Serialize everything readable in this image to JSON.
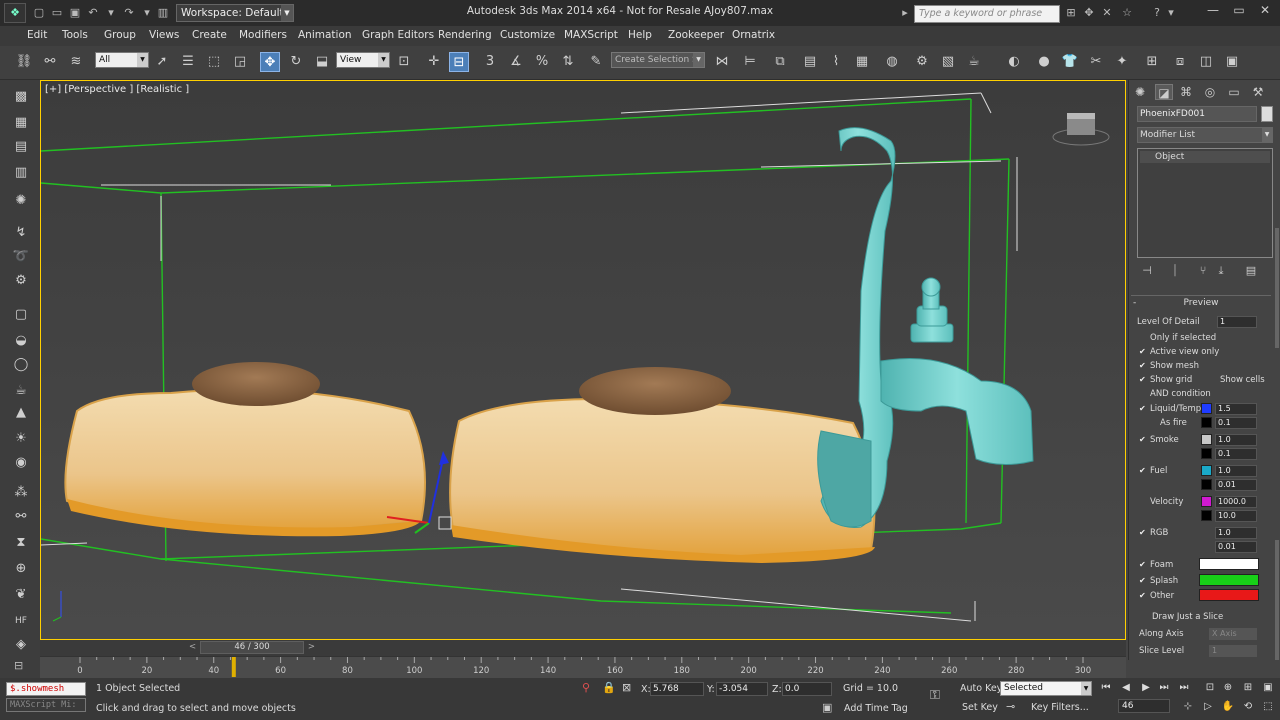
{
  "titlebar": {
    "workspace_label": "Workspace: Default",
    "window_title": "Autodesk 3ds Max  2014 x64    -  Not for Resale      AJoy807.max",
    "search_placeholder": "Type a keyword or phrase"
  },
  "menu": [
    "Edit",
    "Tools",
    "Group",
    "Views",
    "Create",
    "Modifiers",
    "Animation",
    "Graph Editors",
    "Rendering",
    "Customize",
    "MAXScript",
    "Help",
    "Zookeeper",
    "Ornatrix"
  ],
  "toolbar": {
    "filter_value": "All",
    "refcoord_value": "View",
    "selection_set_placeholder": "Create Selection Se"
  },
  "viewport": {
    "label": "[+] [Perspective ] [Realistic ]"
  },
  "command_panel": {
    "object_name": "PhoenixFD001",
    "modifier_list": "Modifier List",
    "stack_item": "Object",
    "rollout_title": "Preview",
    "rollout_mark": "-",
    "level_of_detail_label": "Level Of Detail",
    "level_of_detail_value": "1",
    "only_if_selected": "Only if selected",
    "active_view_only": "Active view only",
    "show_mesh": "Show mesh",
    "show_grid": "Show grid",
    "show_cells": "Show cells",
    "and_condition": "AND condition",
    "liquid_temp": "Liquid/Temp.",
    "liquid_temp_v1": "1.5",
    "liquid_temp_v2": "0.1",
    "as_fire": "As fire",
    "smoke": "Smoke",
    "smoke_v1": "1.0",
    "smoke_v2": "0.1",
    "fuel": "Fuel",
    "fuel_v1": "1.0",
    "fuel_v2": "0.01",
    "velocity": "Velocity",
    "velocity_v1": "1000.0",
    "velocity_v2": "10.0",
    "rgb": "RGB",
    "rgb_v1": "1.0",
    "rgb_v2": "0.01",
    "foam": "Foam",
    "splash": "Splash",
    "other": "Other",
    "draw_slice": "Draw Just a Slice",
    "along_axis_label": "Along Axis",
    "along_axis_value": "X Axis",
    "slice_level_label": "Slice Level",
    "slice_level_value": "1",
    "colors": {
      "liquid": "#1f3cff",
      "smoke": "#c8c8c8",
      "fuel": "#1aa9c8",
      "velocity": "#d01ad0",
      "foam": "#ffffff",
      "splash": "#18d018",
      "other": "#e81818"
    }
  },
  "timeline": {
    "thumb_label": "46 / 300",
    "ticks": [
      "0",
      "20",
      "40",
      "60",
      "80",
      "100",
      "120",
      "140",
      "160",
      "180",
      "200",
      "220",
      "240",
      "260",
      "280",
      "300"
    ]
  },
  "status": {
    "maxscript_value": "$.showmesh",
    "maxscript_label": "MAXScript Mi:",
    "selected_text": "1 Object Selected",
    "prompt_text": "Click and drag to select and move objects",
    "x_label": "X:",
    "x_value": "5.768",
    "y_label": "Y:",
    "y_value": "-3.054",
    "z_label": "Z:",
    "z_value": "0.0",
    "grid_text": "Grid = 10.0",
    "add_time_tag": "Add Time Tag",
    "auto_key": "Auto Key",
    "set_key": "Set Key",
    "selected_dropdown": "Selected",
    "key_filters": "Key Filters...",
    "frame_value": "46"
  }
}
